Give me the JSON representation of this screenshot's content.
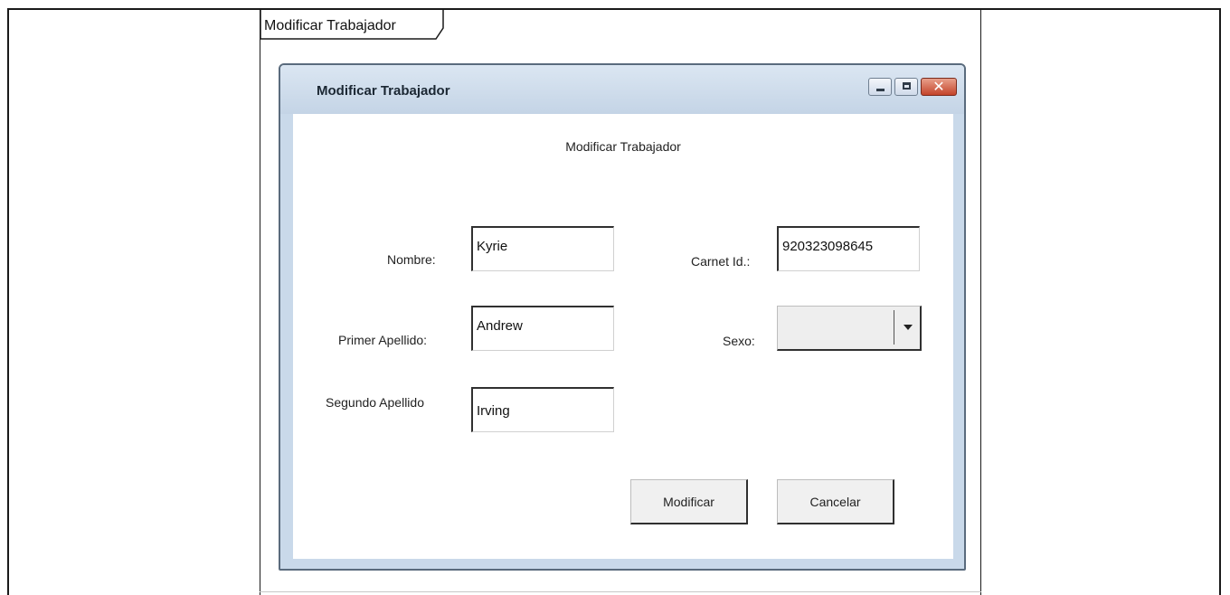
{
  "tab": {
    "label": "Modificar Trabajador"
  },
  "window": {
    "title": "Modificar Trabajador",
    "controls": {
      "minimize": "minimize-icon",
      "maximize": "maximize-icon",
      "close": "close-icon",
      "close_glyph": "✕"
    }
  },
  "form": {
    "heading": "Modificar Trabajador",
    "nombre": {
      "label": "Nombre:",
      "value": "Kyrie"
    },
    "primer_apellido": {
      "label": "Primer Apellido:",
      "value": "Andrew"
    },
    "segundo_apellido": {
      "label": "Segundo Apellido",
      "value": "Irving"
    },
    "carnet": {
      "label": "Carnet Id.:",
      "value": "920323098645"
    },
    "sexo": {
      "label": "Sexo:",
      "value": ""
    }
  },
  "buttons": {
    "modificar": "Modificar",
    "cancelar": "Cancelar"
  }
}
